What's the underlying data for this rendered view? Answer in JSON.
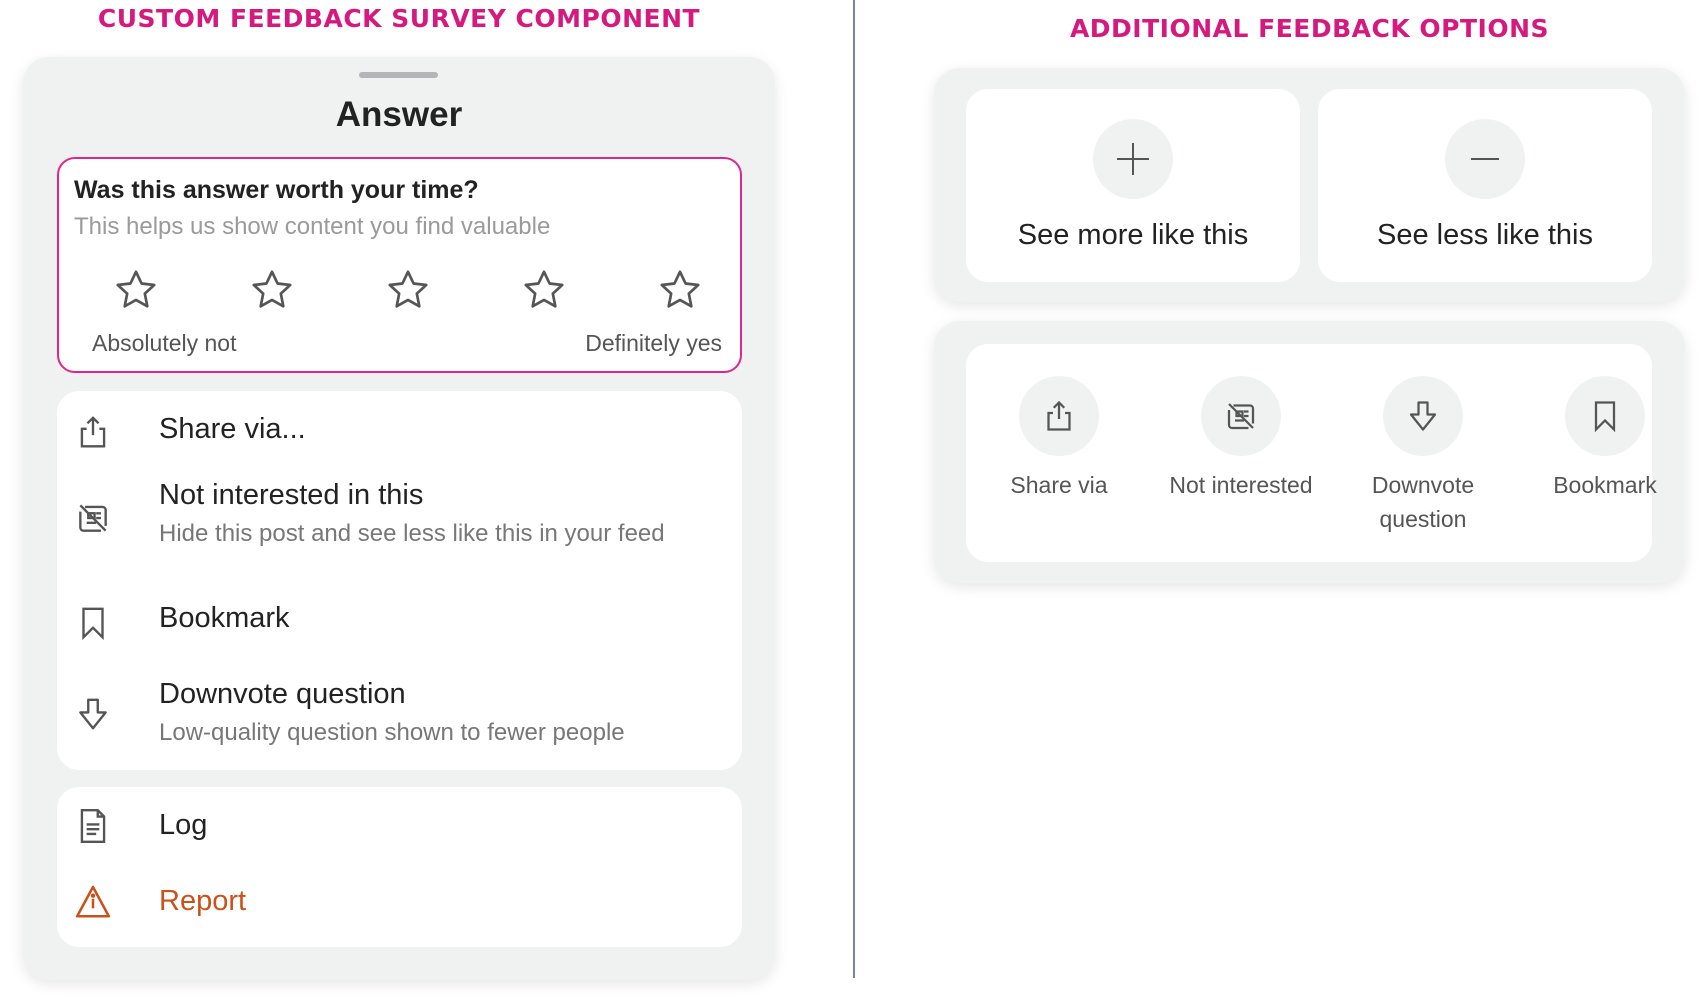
{
  "left_section": {
    "title": "CUSTOM FEEDBACK SURVEY COMPONENT",
    "sheet_title": "Answer",
    "survey": {
      "question": "Was this answer worth your time?",
      "subtitle": "This helps us show content you find valuable",
      "rating": {
        "max_stars": 5,
        "selected": 0
      },
      "label_low": "Absolutely not",
      "label_high": "Definitely yes",
      "accent_color": "#e0268c"
    },
    "menu": [
      {
        "icon": "share-icon",
        "label": "Share via...",
        "description": ""
      },
      {
        "icon": "not-interested-icon",
        "label": "Not interested in this",
        "description": "Hide this post and see less like this in your feed"
      },
      {
        "icon": "bookmark-icon",
        "label": "Bookmark",
        "description": ""
      },
      {
        "icon": "downvote-icon",
        "label": "Downvote question",
        "description": "Low-quality question shown to fewer people"
      }
    ],
    "menu2": [
      {
        "icon": "log-icon",
        "label": "Log"
      },
      {
        "icon": "warning-icon",
        "label": "Report",
        "color": "#c9511a"
      }
    ]
  },
  "right_section": {
    "title": "ADDITIONAL FEEDBACK OPTIONS",
    "tiles": [
      {
        "icon": "plus-icon",
        "label": "See more like this"
      },
      {
        "icon": "minus-icon",
        "label": "See less like this"
      }
    ],
    "options": [
      {
        "icon": "share-icon",
        "label": "Share via"
      },
      {
        "icon": "not-interested-icon",
        "label": "Not interested"
      },
      {
        "icon": "downvote-icon",
        "label": "Downvote question"
      },
      {
        "icon": "bookmark-icon",
        "label": "Bookmark"
      }
    ]
  },
  "colors": {
    "title": "#d6197e",
    "panel_bg": "#f0f1f1",
    "divider": "#7a8597"
  }
}
